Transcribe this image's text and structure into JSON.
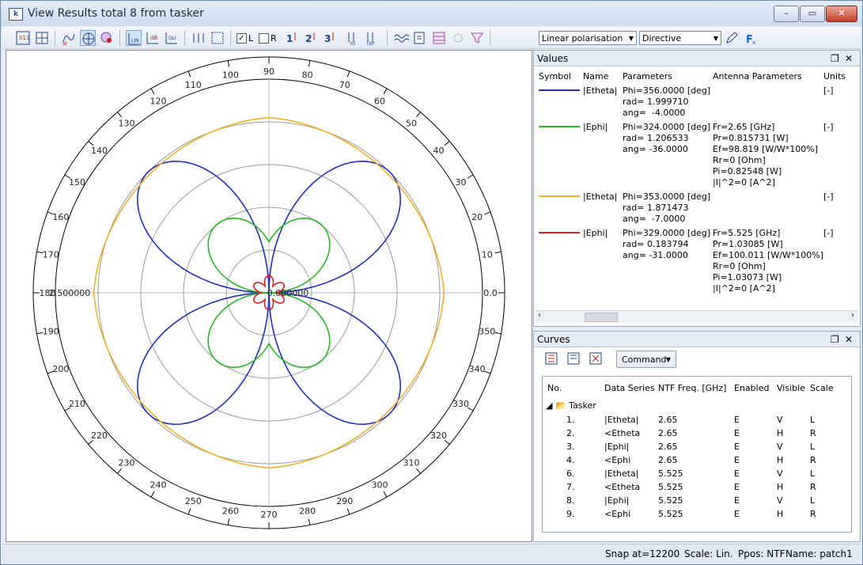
{
  "window": {
    "title": "View Results total 8 from tasker",
    "app_icon_text": "k"
  },
  "toolbar": {
    "check_L": "L",
    "check_R": "R",
    "polarisation_select": "Linear polarisation",
    "gain_select": "Directive",
    "btn_labels": {
      "s11": "S11",
      "fit": "FIT",
      "lin": "LIN",
      "db": "dB",
      "qu": "QU",
      "num1": "1",
      "num2": "2",
      "num3": "3",
      "ftol": "fTO",
      "def": "DEF"
    }
  },
  "plot": {
    "type": "polar",
    "center_label": "0.000000",
    "outer_label": "2.500000",
    "angle_labels": [
      "0.0",
      "10",
      "20",
      "30",
      "40",
      "50",
      "60",
      "70",
      "80",
      "90",
      "100",
      "110",
      "120",
      "130",
      "140",
      "150",
      "160",
      "170",
      "180",
      "190",
      "200",
      "210",
      "220",
      "230",
      "240",
      "250",
      "260",
      "270",
      "280",
      "290",
      "300",
      "310",
      "320",
      "330",
      "340",
      "350"
    ],
    "colors": {
      "etheta_265": "#1f2fbf",
      "ephi_265": "#22bb22",
      "etheta_5525": "#f0b020",
      "ephi_5525": "#dd1f1f"
    }
  },
  "chart_data": {
    "type": "polar",
    "rmax": 2.5,
    "radial_labels": [
      "0.000000",
      "2.500000"
    ],
    "angle_labels": [
      "0.0",
      "10",
      "20",
      "30",
      "40",
      "50",
      "60",
      "70",
      "80",
      "90",
      "100",
      "110",
      "120",
      "130",
      "140",
      "150",
      "160",
      "170",
      "180",
      "190",
      "200",
      "210",
      "220",
      "230",
      "240",
      "250",
      "260",
      "270",
      "280",
      "290",
      "300",
      "310",
      "320",
      "330",
      "340",
      "350"
    ],
    "series": [
      {
        "name": "|Etheta|",
        "freq": "2.65",
        "color": "#1f2fbf",
        "shape": "four-lobe",
        "max": 2.0,
        "lobe_axes": [
          45,
          135,
          225,
          315
        ]
      },
      {
        "name": "|Ephi|",
        "freq": "2.65",
        "color": "#22bb22",
        "shape": "four-lobe",
        "max": 1.36,
        "lobe_axes": [
          70,
          110,
          250,
          290
        ]
      },
      {
        "name": "|Etheta|",
        "freq": "5.525",
        "color": "#f0b020",
        "shape": "circle",
        "max": 2.05
      },
      {
        "name": "|Ephi|",
        "freq": "5.525",
        "color": "#dd1f1f",
        "shape": "small",
        "max": 0.2
      }
    ]
  },
  "values_panel": {
    "title": "Values",
    "headers": [
      "Symbol",
      "Name",
      "Parameters",
      "Antenna Parameters",
      "Units"
    ],
    "rows": [
      {
        "color": "#1f2fbf",
        "name": "|Etheta|",
        "params": [
          "Phi=356.0000 [deg]",
          "rad= 1.999710",
          "ang=  -4.0000"
        ],
        "antenna": [],
        "units": "[-]"
      },
      {
        "color": "#22bb22",
        "name": "|Ephi|",
        "params": [
          "Phi=324.0000 [deg]",
          "rad= 1.206533",
          "ang= -36.0000"
        ],
        "antenna": [
          "Fr=2.65 [GHz]",
          "Pr=0.815731 [W]",
          "Ef=98.819 [W/W*100%]",
          "Rr=0 [Ohm]",
          "Pi=0.82548 [W]",
          "|I|^2=0 [A^2]"
        ],
        "units": "[-]"
      },
      {
        "color": "#f0b020",
        "name": "|Etheta|",
        "params": [
          "Phi=353.0000 [deg]",
          "rad= 1.871473",
          "ang=  -7.0000"
        ],
        "antenna": [],
        "units": "[-]"
      },
      {
        "color": "#dd1f1f",
        "name": "|Ephi|",
        "params": [
          "Phi=329.0000 [deg]",
          "rad= 0.183794",
          "ang= -31.0000"
        ],
        "antenna": [
          "Fr=5.525 [GHz]",
          "Pr=1.03085 [W]",
          "Ef=100.011 [W/W*100%]",
          "Rr=0 [Ohm]",
          "Pi=1.03073 [W]",
          "|I|^2=0 [A^2]"
        ],
        "units": "[-]"
      }
    ]
  },
  "curves_panel": {
    "title": "Curves",
    "command_label": "Command",
    "headers": [
      "No.",
      "Data Series",
      "NTF Freq. [GHz]",
      "Enabled",
      "Visible",
      "Scale"
    ],
    "group": "Tasker",
    "rows": [
      [
        "1.",
        "|Etheta|",
        "2.65",
        "E",
        "V",
        "L"
      ],
      [
        "2.",
        "<Etheta",
        "2.65",
        "E",
        "H",
        "R"
      ],
      [
        "3.",
        "|Ephi|",
        "2.65",
        "E",
        "V",
        "L"
      ],
      [
        "4.",
        "<Ephi",
        "2.65",
        "E",
        "H",
        "R"
      ],
      [
        "6.",
        "|Etheta|",
        "5.525",
        "E",
        "V",
        "L"
      ],
      [
        "7.",
        "<Etheta",
        "5.525",
        "E",
        "H",
        "R"
      ],
      [
        "8.",
        "|Ephi|",
        "5.525",
        "E",
        "V",
        "L"
      ],
      [
        "9.",
        "<Ephi",
        "5.525",
        "E",
        "H",
        "R"
      ]
    ]
  },
  "status": {
    "snap": "Snap at=12200",
    "scale": "Scale: Lin.",
    "ppos": "Ppos: NTF",
    "name": "Name: patch1"
  }
}
